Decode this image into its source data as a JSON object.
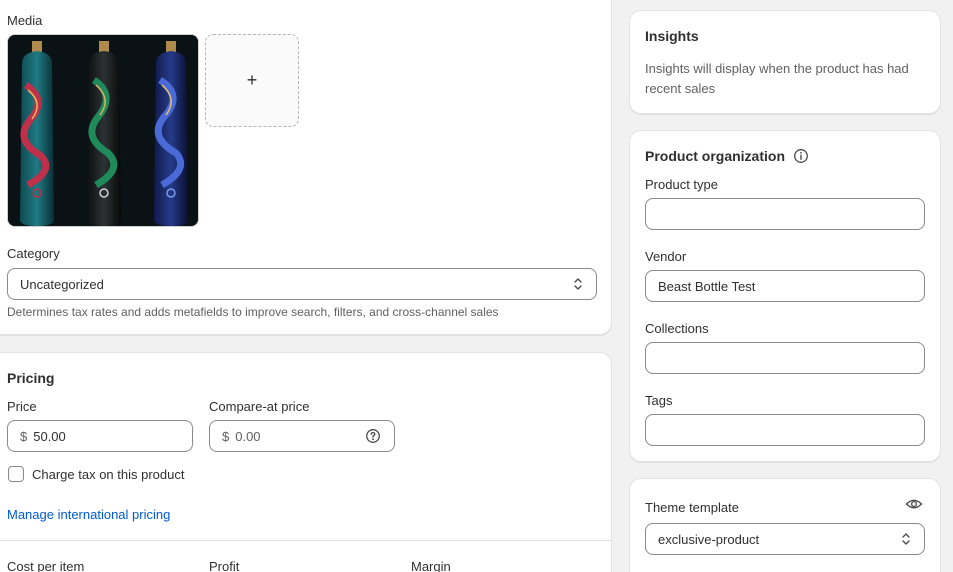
{
  "media": {
    "heading": "Media",
    "add_symbol": "+",
    "image_alt": "Three dragon-themed water bottles"
  },
  "category": {
    "label": "Category",
    "value": "Uncategorized",
    "help": "Determines tax rates and adds metafields to improve search, filters, and cross-channel sales"
  },
  "pricing": {
    "heading": "Pricing",
    "price_label": "Price",
    "currency": "$",
    "price_value": "50.00",
    "compare_label": "Compare-at price",
    "compare_placeholder": "0.00",
    "charge_tax_label": "Charge tax on this product",
    "international_link": "Manage international pricing",
    "cost_label": "Cost per item",
    "profit_label": "Profit",
    "margin_label": "Margin"
  },
  "insights": {
    "heading": "Insights",
    "body": "Insights will display when the product has had recent sales"
  },
  "organization": {
    "heading": "Product organization",
    "product_type_label": "Product type",
    "product_type_value": "",
    "vendor_label": "Vendor",
    "vendor_value": "Beast Bottle Test",
    "collections_label": "Collections",
    "collections_value": "",
    "tags_label": "Tags",
    "tags_value": ""
  },
  "theme": {
    "heading": "Theme template",
    "value": "exclusive-product"
  },
  "icons": {
    "info": "info-icon",
    "eye": "eye-icon",
    "help": "help-circle-icon",
    "chevron": "chevron-up-down-icon"
  },
  "colors": {
    "link": "#005bd3",
    "background": "#f1f1f1",
    "card": "#ffffff"
  }
}
